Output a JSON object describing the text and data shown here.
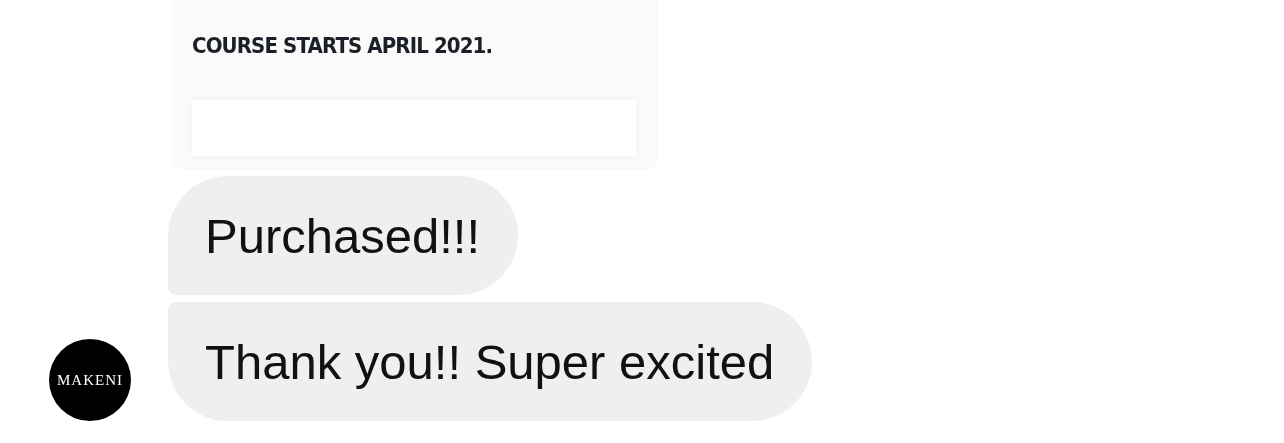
{
  "shared_post": {
    "caption": "COURSE STARTS APRIL 2021."
  },
  "messages": [
    {
      "text": "Purchased!!!",
      "show_avatar": false
    },
    {
      "text": "Thank you!! Super excited",
      "show_avatar": true
    }
  ],
  "avatar": {
    "label": "MAKENI"
  }
}
